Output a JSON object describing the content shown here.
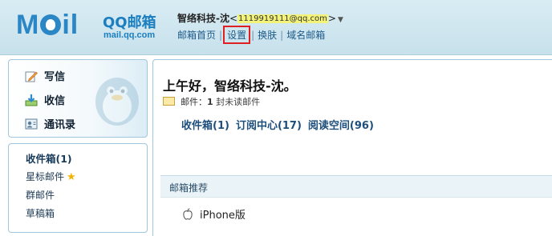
{
  "brand": {
    "logo": "MOil",
    "name_cn": "QQ邮箱",
    "url": "mail.qq.com"
  },
  "user": {
    "name": "智络科技-沈",
    "email_open": "<",
    "email": "1119919111@qq.com",
    "email_close": ">",
    "dropdown_arrow": "▼"
  },
  "top_nav": {
    "home": "邮箱首页",
    "settings": "设置",
    "skin": "换肤",
    "domain": "域名邮箱",
    "separator": "|"
  },
  "sidebar": {
    "actions": [
      {
        "label": "写信",
        "icon": "pencil-icon"
      },
      {
        "label": "收信",
        "icon": "inbox-download-icon"
      },
      {
        "label": "通讯录",
        "icon": "address-book-icon"
      }
    ],
    "folders": [
      {
        "label": "收件箱(1)"
      },
      {
        "label": "星标邮件",
        "icon": "star-icon"
      },
      {
        "label": "群邮件"
      },
      {
        "label": "草稿箱"
      }
    ]
  },
  "main": {
    "greeting": "上午好，智络科技-沈。",
    "mail_label": "邮件：",
    "mail_count": "1",
    "mail_unread_text": "封未读邮件",
    "quick_links": [
      "收件箱(1)",
      "订阅中心(17)",
      "阅读空间(96)"
    ],
    "recommend_title": "邮箱推荐",
    "recommend_item": "iPhone版"
  },
  "colors": {
    "header_bg": "#c7e1ec",
    "link": "#1e5b8a",
    "highlight_box": "#e02020",
    "brand_blue": "#2a86c4"
  }
}
